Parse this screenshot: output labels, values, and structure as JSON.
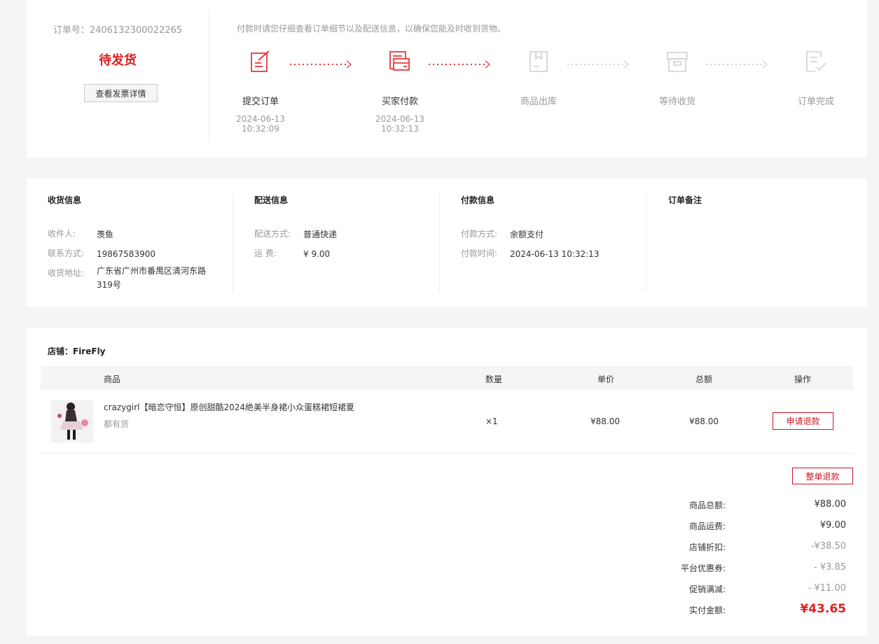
{
  "status": {
    "order_no_label": "订单号：2406132300022265",
    "status_text": "待发货",
    "invoice_button": "查看发票详情",
    "pay_hint": "付款时请您仔细查看订单细节以及配送信息，以确保您能及时收到货物。",
    "steps": [
      {
        "label": "提交订单",
        "date": "2024-06-13",
        "time": "10:32:09",
        "icon": "submit-order-icon",
        "active": true
      },
      {
        "label": "买家付款",
        "date": "2024-06-13",
        "time": "10:32:13",
        "icon": "payment-card-icon",
        "active": true
      },
      {
        "label": "商品出库",
        "date": "",
        "time": "",
        "icon": "outbound-box-icon",
        "active": false
      },
      {
        "label": "等待收货",
        "date": "",
        "time": "",
        "icon": "receive-box-icon",
        "active": false
      },
      {
        "label": "订单完成",
        "date": "",
        "time": "",
        "icon": "order-complete-icon",
        "active": false
      }
    ],
    "active_color": "#e4393c",
    "inactive_color": "#d0d0d0"
  },
  "receiver": {
    "title": "收货信息",
    "name_label": "收件人:",
    "name": "羡鱼",
    "phone_label": "联系方式:",
    "phone": "19867583900",
    "address_label": "收货地址:",
    "address": "广东省广州市番禺区清河东路319号"
  },
  "delivery": {
    "title": "配送信息",
    "method_label": "配送方式:",
    "method": "普通快递",
    "fee_label": "运 费:",
    "fee": "¥ 9.00"
  },
  "payment": {
    "title": "付款信息",
    "method_label": "付款方式:",
    "method": "余额支付",
    "time_label": "付款时间:",
    "time": "2024-06-13 10:32:13"
  },
  "remark": {
    "title": "订单备注"
  },
  "goods": {
    "shop_label": "店铺：FireFly",
    "headers": {
      "product": "商品",
      "qty": "数量",
      "price": "单价",
      "total": "总额",
      "action": "操作"
    },
    "items": [
      {
        "name": "crazygirl【暗恋守恒】原创甜酷2024绝美半身裙小众蛋糕裙短裙夏",
        "spec": "都有货",
        "qty": "×1",
        "price": "¥88.00",
        "total": "¥88.00",
        "action": "申请退款"
      }
    ],
    "refund_all": "整单退款"
  },
  "summary": [
    {
      "label": "商品总额:",
      "value": "¥88.00",
      "style": "normal"
    },
    {
      "label": "商品运费:",
      "value": "¥9.00",
      "style": "normal"
    },
    {
      "label": "店铺折扣:",
      "value": "-¥38.50",
      "style": "muted"
    },
    {
      "label": "平台优惠券:",
      "value": "- ¥3.85",
      "style": "muted"
    },
    {
      "label": "促销满减:",
      "value": "- ¥11.00",
      "style": "muted"
    },
    {
      "label": "实付金额:",
      "value": "¥43.65",
      "style": "total"
    }
  ]
}
